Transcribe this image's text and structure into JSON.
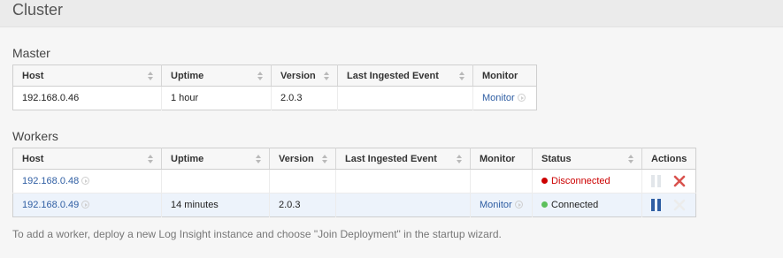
{
  "page": {
    "title": "Cluster"
  },
  "master": {
    "title": "Master",
    "columns": [
      "Host",
      "Uptime",
      "Version",
      "Last Ingested Event",
      "Monitor"
    ],
    "rows": [
      {
        "host": "192.168.0.46",
        "uptime": "1 hour",
        "version": "2.0.3",
        "last_event": "",
        "monitor": "Monitor"
      }
    ]
  },
  "workers": {
    "title": "Workers",
    "columns": [
      "Host",
      "Uptime",
      "Version",
      "Last Ingested Event",
      "Monitor",
      "Status",
      "Actions"
    ],
    "rows": [
      {
        "host": "192.168.0.48",
        "uptime": "",
        "version": "",
        "last_event": "",
        "monitor": "",
        "status": "Disconnected",
        "status_color": "#cc0000"
      },
      {
        "host": "192.168.0.49",
        "uptime": "14 minutes",
        "version": "2.0.3",
        "last_event": "",
        "monitor": "Monitor",
        "status": "Connected",
        "status_color": "#5cc05c"
      }
    ]
  },
  "footnote": "To add a worker, deploy a new Log Insight instance and choose \"Join Deployment\" in the startup wizard.",
  "colors": {
    "link": "#2f5ea3",
    "pause_active": "#2f5ea3",
    "pause_disabled": "#e2e6ea",
    "remove_active": "#d9534f",
    "remove_disabled": "#ececec"
  },
  "icons": [
    "sort-icon",
    "circle-arrow-icon",
    "pause-icon",
    "remove-icon",
    "status-dot-icon"
  ]
}
